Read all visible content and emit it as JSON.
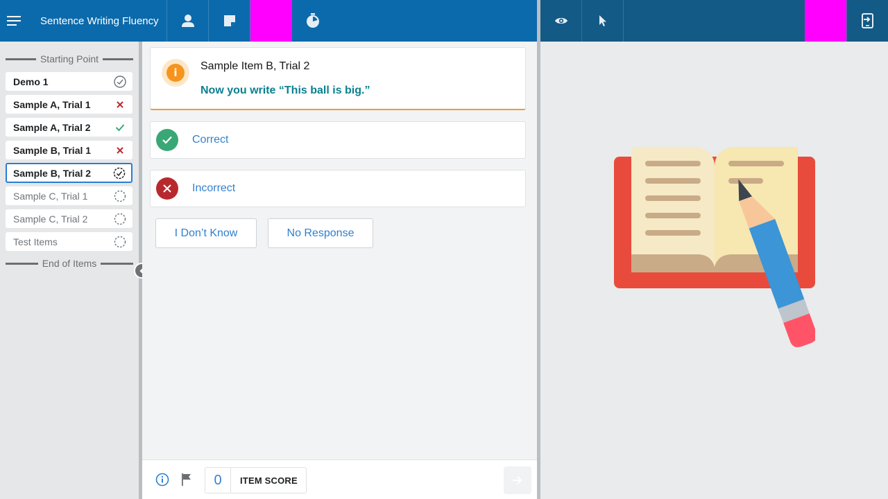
{
  "header": {
    "title": "Sentence Writing Fluency",
    "menu_icon": "hamburger-menu-icon",
    "icons": [
      "user-icon",
      "note-icon",
      "timer-icon"
    ],
    "accent_color": "#0b6aab"
  },
  "right_header": {
    "icons": [
      "eye-icon",
      "cursor-icon",
      "exit-screen-icon"
    ],
    "background": "#135a86"
  },
  "sidebar": {
    "start_label": "Starting Point",
    "end_label": "End of Items",
    "items": [
      {
        "label": "Demo 1",
        "status": "done"
      },
      {
        "label": "Sample A, Trial 1",
        "status": "incorrect"
      },
      {
        "label": "Sample A, Trial 2",
        "status": "correct"
      },
      {
        "label": "Sample B, Trial 1",
        "status": "incorrect"
      },
      {
        "label": "Sample B, Trial 2",
        "status": "current"
      },
      {
        "label": "Sample C, Trial 1",
        "status": "pending"
      },
      {
        "label": "Sample C, Trial 2",
        "status": "pending"
      },
      {
        "label": "Test Items",
        "status": "pending"
      }
    ]
  },
  "prompt": {
    "title": "Sample Item B, Trial 2",
    "text": "Now you write “This ball is big.”"
  },
  "responses": {
    "correct_label": "Correct",
    "incorrect_label": "Incorrect",
    "correct_color": "#3aa876",
    "incorrect_color": "#c0282d"
  },
  "buttons": {
    "dont_know": "I Don’t Know",
    "no_response": "No Response"
  },
  "footer": {
    "item_score_value": "0",
    "item_score_label": "ITEM SCORE"
  }
}
